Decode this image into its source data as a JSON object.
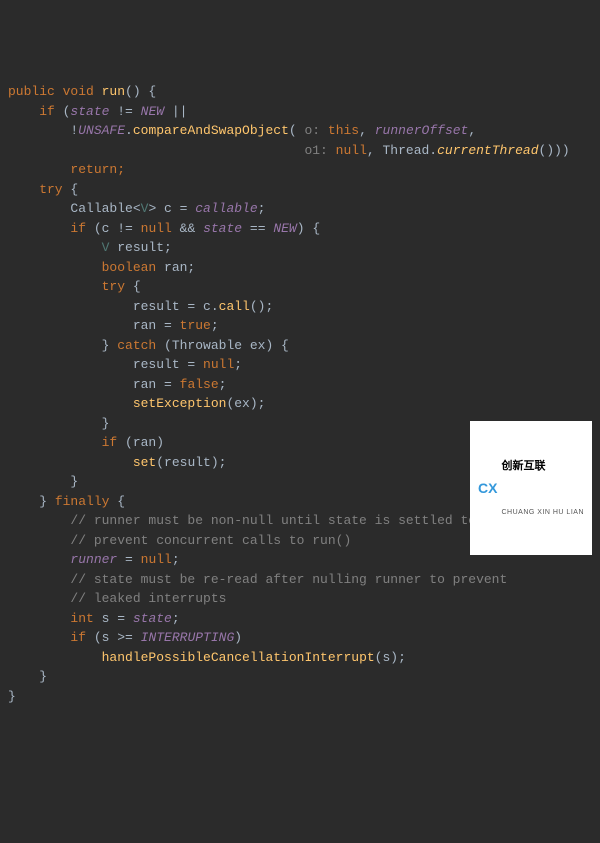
{
  "code": {
    "l1a": "public void ",
    "l1b": "run",
    "l1c": "() {",
    "l2a": "    if ",
    "l2b": "(",
    "l2c": "state",
    "l2d": " != ",
    "l2e": "NEW",
    "l2f": " ||",
    "l3a": "        !",
    "l3b": "UNSAFE",
    "l3c": ".",
    "l3d": "compareAndSwapObject",
    "l3e": "(",
    "l3f": " o: ",
    "l3g": "this",
    "l3h": ", ",
    "l3i": "runnerOffset",
    "l3j": ",",
    "l4a": "                                      ",
    "l4b": "o1: ",
    "l4c": "null",
    "l4d": ", Thread.",
    "l4e": "currentThread",
    "l4f": "()))",
    "l5a": "        return;",
    "l6a": "    try ",
    "l6b": "{",
    "l7a": "        Callable<",
    "l7b": "V",
    "l7c": "> c = ",
    "l7d": "callable",
    "l7e": ";",
    "l8a": "        if ",
    "l8b": "(c != ",
    "l8c": "null",
    "l8d": " && ",
    "l8e": "state",
    "l8f": " == ",
    "l8g": "NEW",
    "l8h": ") {",
    "l9a": "            ",
    "l9b": "V",
    "l9c": " result;",
    "l10a": "            boolean ",
    "l10b": "ran;",
    "l11a": "            try ",
    "l11b": "{",
    "l12a": "                result = c.",
    "l12b": "call",
    "l12c": "();",
    "l13a": "                ran = ",
    "l13b": "true",
    "l13c": ";",
    "l14a": "            } ",
    "l14b": "catch ",
    "l14c": "(Throwable ex) {",
    "l15a": "                result = ",
    "l15b": "null",
    "l15c": ";",
    "l16a": "                ran = ",
    "l16b": "false",
    "l16c": ";",
    "l17a": "                ",
    "l17b": "setException",
    "l17c": "(ex);",
    "l18a": "            }",
    "l19a": "            if ",
    "l19b": "(ran)",
    "l20a": "                ",
    "l20b": "set",
    "l20c": "(result);",
    "l21a": "        }",
    "l22a": "    } ",
    "l22b": "finally ",
    "l22c": "{",
    "l23a": "        // runner must be non-null until state is settled to",
    "l24a": "        // prevent concurrent calls to run()",
    "l25a": "        ",
    "l25b": "runner",
    "l25c": " = ",
    "l25d": "null",
    "l25e": ";",
    "l26a": "        // state must be re-read after nulling runner to prevent",
    "l27a": "        // leaked interrupts",
    "l28a": "        int ",
    "l28b": "s = ",
    "l28c": "state",
    "l28d": ";",
    "l29a": "        if ",
    "l29b": "(s >= ",
    "l29c": "INTERRUPTING",
    "l29d": ")",
    "l30a": "            ",
    "l30b": "handlePossibleCancellationInterrupt",
    "l30c": "(s);",
    "l31a": "    }",
    "l32a": "}"
  },
  "watermark": {
    "icon": "CX",
    "main": "创新互联",
    "sub": "CHUANG XIN HU LIAN"
  }
}
